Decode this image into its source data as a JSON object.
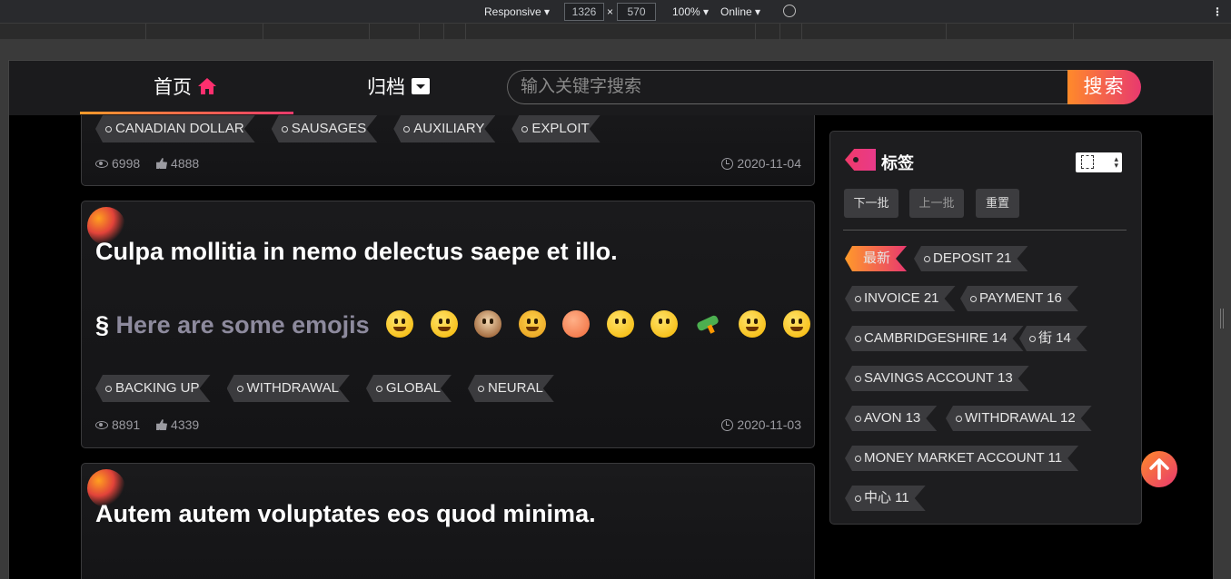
{
  "devtools": {
    "mode": "Responsive",
    "width": "1326",
    "height": "570",
    "zoom": "100%",
    "network": "Online",
    "separator": "×"
  },
  "nav": {
    "home_label": "首页",
    "archive_label": "归档",
    "search_placeholder": "输入关键字搜索",
    "search_button": "搜索"
  },
  "posts": [
    {
      "title": "",
      "tags": [
        "CANADIAN DOLLAR",
        "SAUSAGES",
        "AUXILIARY",
        "EXPLOIT"
      ],
      "views": "6998",
      "likes": "4888",
      "date": "2020-11-04"
    },
    {
      "title": "Culpa mollitia in nemo delectus saepe et illo.",
      "heading_symbol": "§",
      "heading_text": "Here are some emojis",
      "tags": [
        "BACKING UP",
        "WITHDRAWAL",
        "GLOBAL",
        "NEURAL"
      ],
      "views": "8891",
      "likes": "4339",
      "date": "2020-11-03"
    },
    {
      "title": "Autem autem voluptates eos quod minima."
    }
  ],
  "sidebar": {
    "title": "标签",
    "next_button": "下一批",
    "prev_button": "上一批",
    "reset_button": "重置",
    "tags": [
      {
        "label": "最新"
      },
      {
        "label": "DEPOSIT 21"
      },
      {
        "label": "INVOICE 21"
      },
      {
        "label": "PAYMENT 16"
      },
      {
        "label": "CAMBRIDGESHIRE 14"
      },
      {
        "label": "街 14"
      },
      {
        "label": "SAVINGS ACCOUNT 13"
      },
      {
        "label": "AVON 13"
      },
      {
        "label": "WITHDRAWAL 12"
      },
      {
        "label": "MONEY MARKET ACCOUNT 11"
      },
      {
        "label": "中心 11"
      }
    ]
  },
  "colors": {
    "accent_start": "#ff9a2a",
    "accent_end": "#e8396f",
    "background": "#000000",
    "card": "#1a1a1c"
  }
}
